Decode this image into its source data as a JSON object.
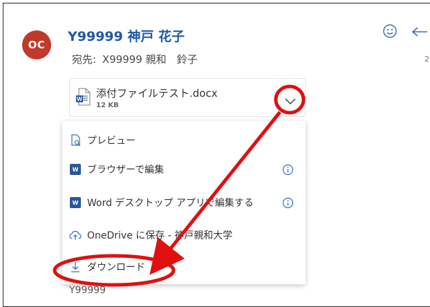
{
  "message": {
    "avatar_initials": "OC",
    "sender": "Y99999 神戸  花子",
    "to_label": "宛先:",
    "to_name": "X99999 親和　鈴子",
    "edge_number": "2",
    "body_fragment": "Y99999"
  },
  "attachment": {
    "file_name": "添付ファイルテスト.docx",
    "file_size": "12 KB",
    "file_icon": "word-doc-icon",
    "expand_icon": "chevron-down-icon"
  },
  "header_icons": [
    "smiley-icon",
    "reply-icon"
  ],
  "menu": {
    "items": [
      {
        "label": "プレビュー",
        "icon": "preview-icon",
        "info": false
      },
      {
        "label": "ブラウザーで編集",
        "icon": "word-icon",
        "info": true
      },
      {
        "label": "Word デスクトップ アプリで編集する",
        "icon": "word-icon",
        "info": true
      },
      {
        "label": "OneDrive に保存 - 神戸親和大学",
        "icon": "cloud-upload-icon",
        "info": false
      },
      {
        "label": "ダウンロード",
        "icon": "download-icon",
        "info": false
      }
    ]
  },
  "colors": {
    "avatar": "#c0392b",
    "sender": "#1e5aa8",
    "annotation_red": "#e01010",
    "word_blue": "#2b579a"
  }
}
